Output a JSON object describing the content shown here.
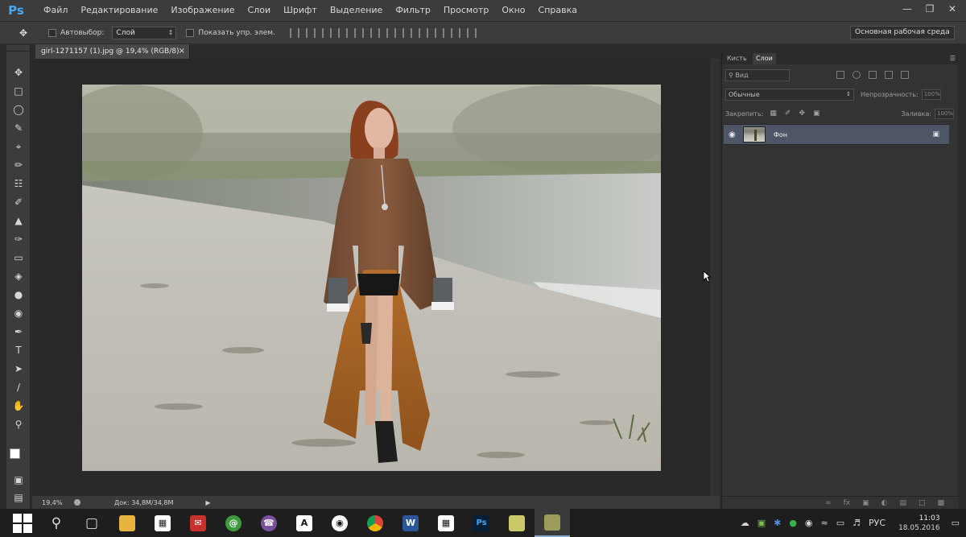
{
  "app": {
    "logo": "Ps"
  },
  "menu": [
    "Файл",
    "Редактирование",
    "Изображение",
    "Слои",
    "Шрифт",
    "Выделение",
    "Фильтр",
    "Просмотр",
    "Окно",
    "Справка"
  ],
  "window_controls": {
    "minimize": "—",
    "restore": "❐",
    "close": "✕"
  },
  "options": {
    "autoselect_label": "Автовыбор:",
    "autoselect_value": "Слой",
    "show_transform_label": "Показать упр. элем.",
    "workspace": "Основная рабочая среда"
  },
  "document": {
    "tab_title": "girl-1271157 (1).jpg @ 19,4% (RGB/8)",
    "close": "×"
  },
  "status": {
    "zoom": "19,4%",
    "doc": "Док: 34,8M/34,8M"
  },
  "panel": {
    "tabs": [
      "Кисть",
      "Слои"
    ],
    "active_tab": "Слои",
    "filter": "Вид",
    "blend_mode": "Обычные",
    "opacity_label": "Непрозрачность:",
    "opacity": "100%",
    "lock_label": "Закрепить:",
    "fill_label": "Заливка:",
    "fill": "100%",
    "layers": [
      {
        "name": "Фон",
        "visible": true,
        "locked": true
      }
    ]
  },
  "taskbar": {
    "lang": "РУС",
    "time": "11:03",
    "date": "18.05.2016",
    "apps": [
      "start",
      "search",
      "task-view",
      "file-explorer",
      "store",
      "mail",
      "viber",
      "font-app",
      "camera",
      "chrome",
      "word",
      "calculator",
      "photoshop",
      "notes",
      "vlc"
    ]
  },
  "colors": {
    "accent": "#46a7f5",
    "selected_layer": "#4d5566"
  }
}
